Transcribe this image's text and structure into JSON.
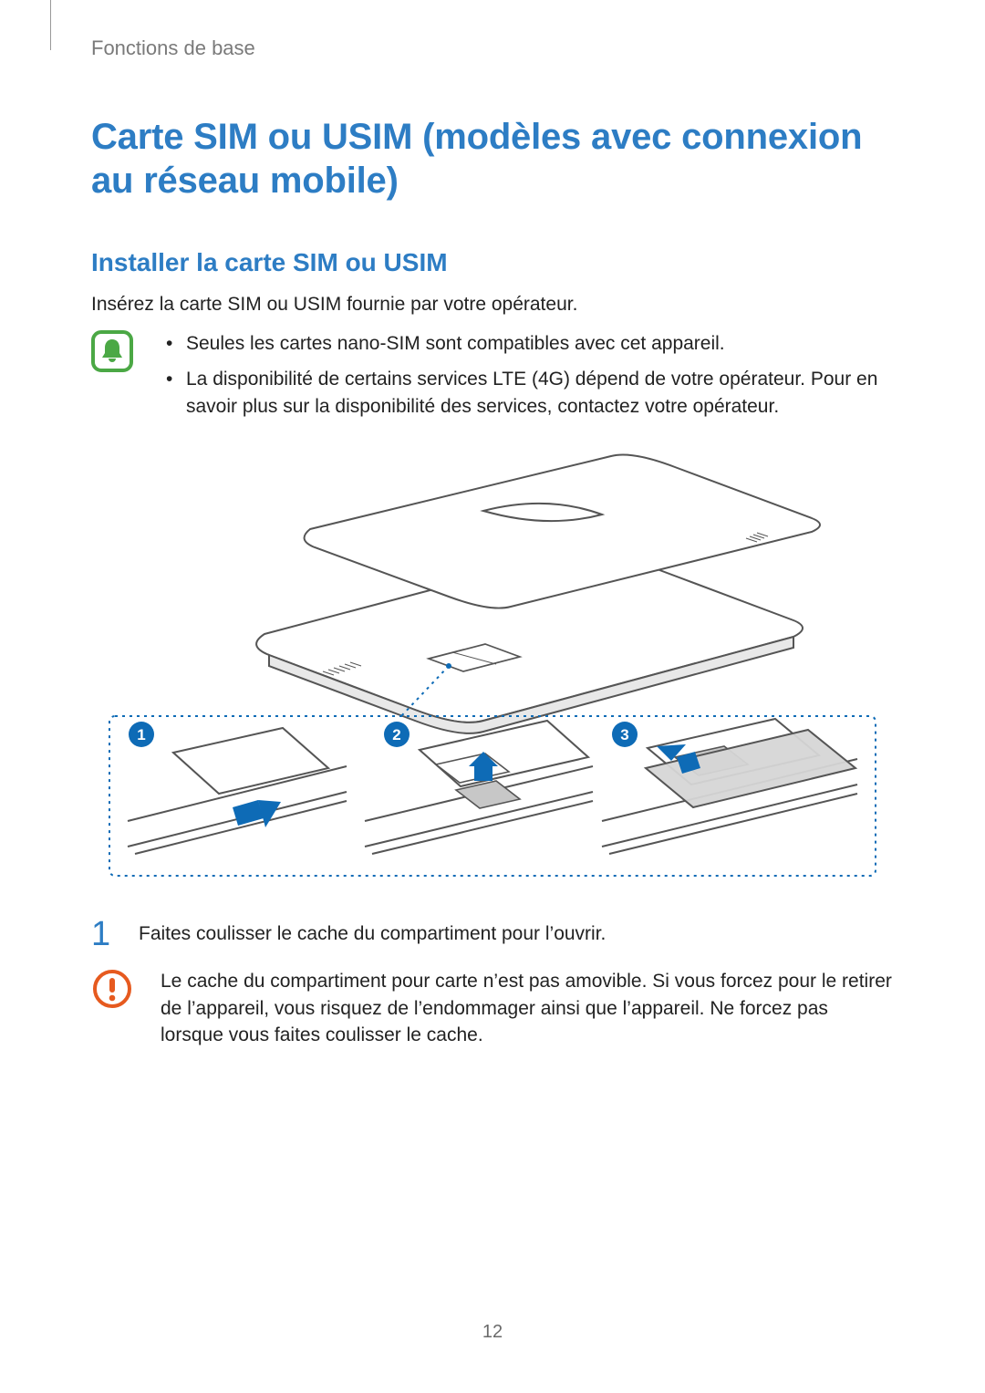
{
  "header": {
    "running_title": "Fonctions de base"
  },
  "title": "Carte SIM ou USIM (modèles avec connexion au réseau mobile)",
  "subtitle": "Installer la carte SIM ou USIM",
  "intro": "Insérez la carte SIM ou USIM fournie par votre opérateur.",
  "notes": [
    "Seules les cartes nano-SIM sont compatibles avec cet appareil.",
    "La disponibilité de certains services LTE (4G) dépend de votre opérateur. Pour en savoir plus sur la disponibilité des services, contactez votre opérateur."
  ],
  "illustration": {
    "step_badges": [
      "1",
      "2",
      "3"
    ]
  },
  "steps": [
    {
      "number": "1",
      "text": "Faites coulisser le cache du compartiment pour l’ouvrir."
    }
  ],
  "caution": "Le cache du compartiment pour carte n’est pas amovible. Si vous forcez pour le retirer de l’appareil, vous risquez de l’endommager ainsi que l’appareil. Ne forcez pas lorsque vous faites coulisser le cache.",
  "page_number": "12"
}
